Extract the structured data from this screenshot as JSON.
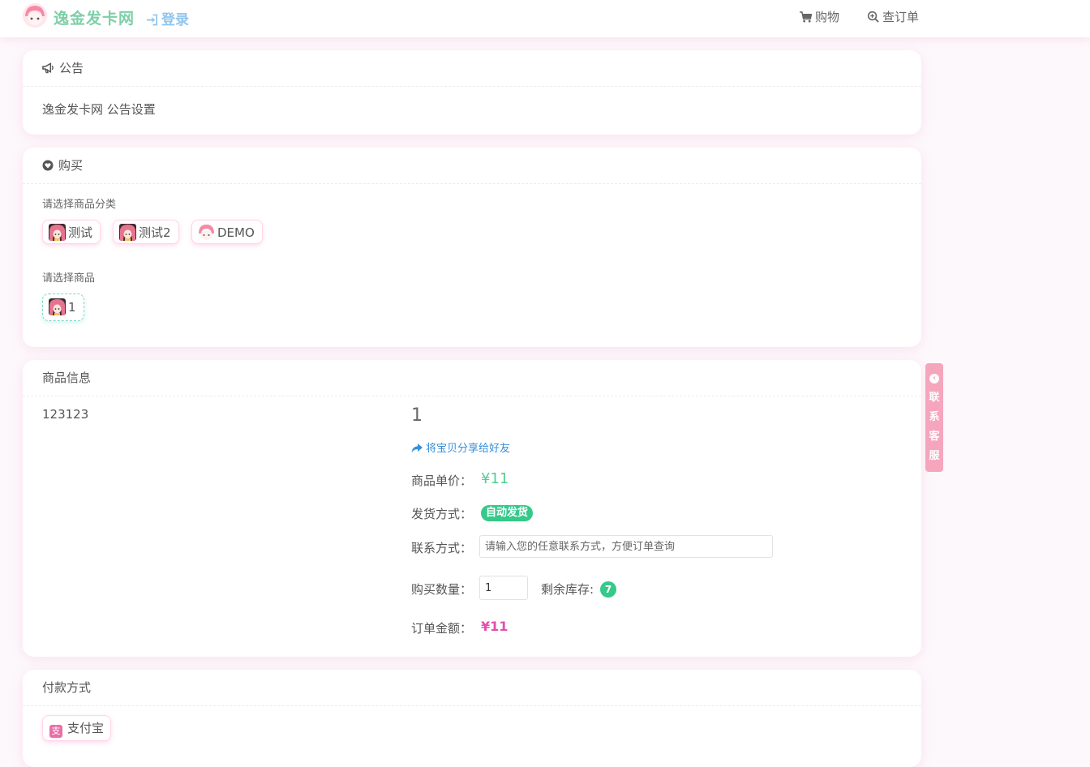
{
  "header": {
    "brand": "逸金发卡网",
    "login": "登录",
    "nav": {
      "cart": "购物",
      "order_query": "查订单"
    }
  },
  "notice": {
    "title": "公告",
    "content": "逸金发卡网 公告设置"
  },
  "buy": {
    "title": "购买",
    "category_label": "请选择商品分类",
    "categories": [
      {
        "label": "测试",
        "icon": "anime-avatar-icon"
      },
      {
        "label": "测试2",
        "icon": "anime-avatar-icon"
      },
      {
        "label": "DEMO",
        "icon": "pink-hair-avatar-icon"
      }
    ],
    "product_label": "请选择商品",
    "products": [
      {
        "label": "1",
        "selected": true
      }
    ]
  },
  "product_info": {
    "title": "商品信息",
    "description": "123123",
    "name": "1",
    "share": "将宝贝分享给好友",
    "price_label": "商品单价：",
    "price": "¥11",
    "delivery_label": "发货方式：",
    "delivery": "自动发货",
    "contact_label": "联系方式：",
    "contact_placeholder": "请输入您的任意联系方式，方便订单查询",
    "quantity_label": "购买数量：",
    "quantity": "1",
    "stock_label": "剩余库存:",
    "stock": "7",
    "total_label": "订单金额：",
    "total": "¥11"
  },
  "payment": {
    "title": "付款方式",
    "methods": [
      {
        "label": "支付宝",
        "icon": "alipay-icon"
      }
    ]
  },
  "side_contact": {
    "label": "联系客服"
  },
  "colors": {
    "brand": "#7fcfa8",
    "login": "#8fc5ef",
    "price": "#4fcf8f",
    "badge": "#35c98a",
    "total": "#e24fae",
    "side_tab": "#f5a6bd"
  }
}
